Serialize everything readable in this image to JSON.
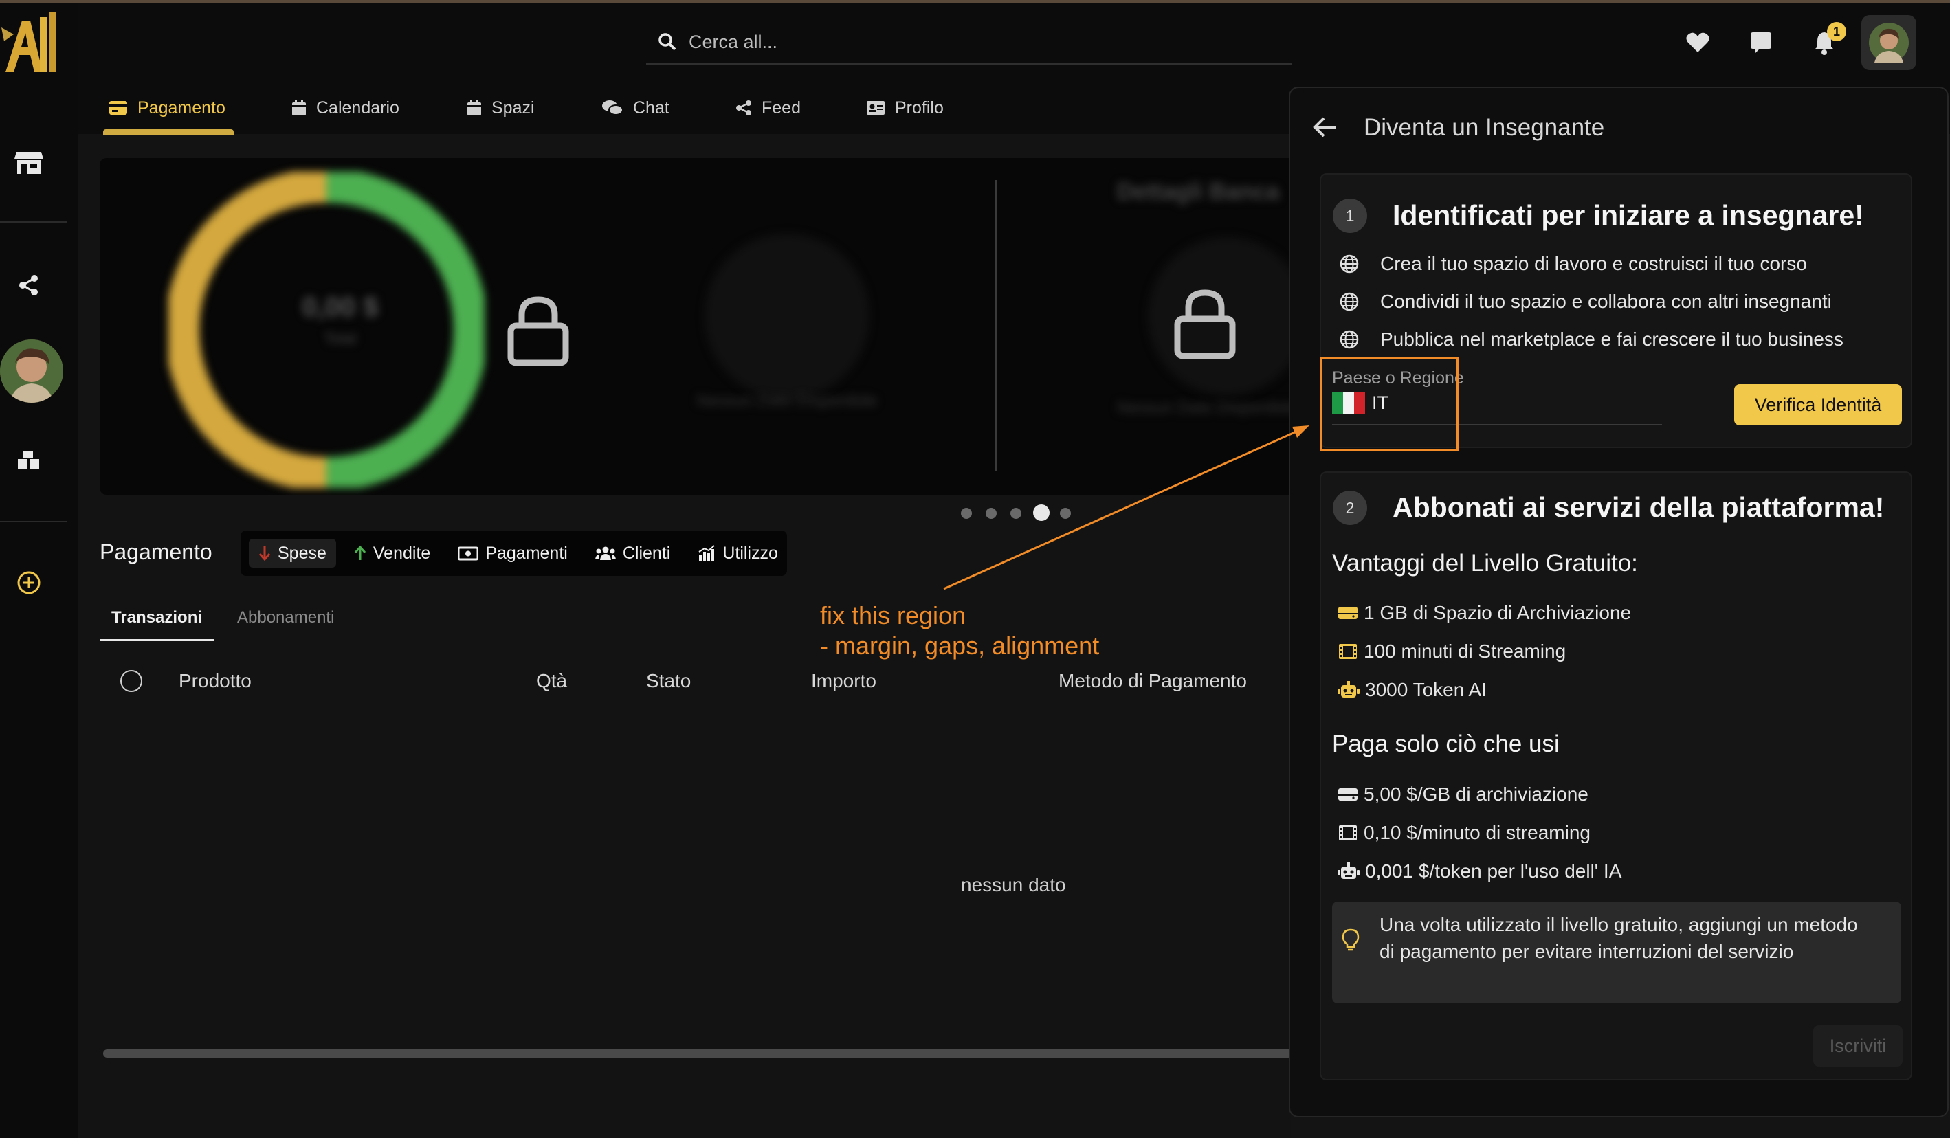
{
  "app": {
    "logo_text": "A",
    "brand_color": "#f2c84b",
    "annotation_color": "#f28c28"
  },
  "sidebar": {
    "items": [
      {
        "icon": "store-icon"
      },
      {
        "icon": "share-icon"
      },
      {
        "icon": "avatar"
      },
      {
        "icon": "blocks-icon"
      },
      {
        "icon": "plus-circle-icon"
      }
    ]
  },
  "search": {
    "placeholder": "Cerca all..."
  },
  "header": {
    "notification_count": "1"
  },
  "tabs": [
    {
      "label": "Pagamento",
      "icon": "credit-card-icon",
      "active": true
    },
    {
      "label": "Calendario",
      "icon": "calendar-icon"
    },
    {
      "label": "Spazi",
      "icon": "calendar-icon"
    },
    {
      "label": "Chat",
      "icon": "chat-bubbles-icon"
    },
    {
      "label": "Feed",
      "icon": "share-icon"
    },
    {
      "label": "Profilo",
      "icon": "id-card-icon"
    }
  ],
  "hero": {
    "total_value": "0,00 $",
    "total_label": "Total",
    "no_data_label": "Nessun Dato Disponibile",
    "bank_title": "Dettagli Banca",
    "carousel_pages": 5,
    "carousel_active": 3
  },
  "payment": {
    "title": "Pagamento",
    "filters": [
      {
        "label": "Spese",
        "icon": "arrow-down-icon",
        "active": true
      },
      {
        "label": "Vendite",
        "icon": "arrow-up-icon"
      },
      {
        "label": "Pagamenti",
        "icon": "cash-icon"
      },
      {
        "label": "Clienti",
        "icon": "users-icon"
      },
      {
        "label": "Utilizzo",
        "icon": "chart-icon"
      }
    ],
    "subtabs": [
      "Transazioni",
      "Abbonamenti"
    ],
    "columns": [
      "Prodotto",
      "Qtà",
      "Stato",
      "Importo",
      "Metodo di Pagamento"
    ],
    "empty_text": "nessun dato"
  },
  "annotation": {
    "text": "fix this region\n- margin, gaps, alignment"
  },
  "panel": {
    "title": "Diventa un Insegnante",
    "step1": {
      "number": "1",
      "title": "Identificati per iniziare a insegnare!",
      "bullets": [
        "Crea il tuo spazio di lavoro e costruisci il tuo corso",
        "Condividi il tuo spazio e collabora con altri insegnanti",
        "Pubblica nel marketplace e fai crescere il tuo business"
      ],
      "region_label": "Paese o Regione",
      "region_value": "IT",
      "verify_label": "Verifica Identità"
    },
    "step2": {
      "number": "2",
      "title": "Abbonati ai servizi della piattaforma!",
      "free_title": "Vantaggi del Livello Gratuito:",
      "free_items": [
        {
          "icon": "storage-icon",
          "text": "1 GB di Spazio di Archiviazione"
        },
        {
          "icon": "film-icon",
          "text": "100 minuti di Streaming"
        },
        {
          "icon": "robot-icon",
          "text": "3000 Token AI"
        }
      ],
      "paid_title": "Paga solo ciò che usi",
      "paid_items": [
        {
          "icon": "storage-icon",
          "text": "5,00 $/GB di archiviazione"
        },
        {
          "icon": "film-icon",
          "text": "0,10 $/minuto di streaming"
        },
        {
          "icon": "robot-icon",
          "text": "0,001 $/token per l'uso dell' IA"
        }
      ],
      "info_text": "Una volta utilizzato il livello gratuito, aggiungi un metodo di pagamento per evitare interruzioni del servizio",
      "subscribe_label": "Iscriviti"
    }
  }
}
